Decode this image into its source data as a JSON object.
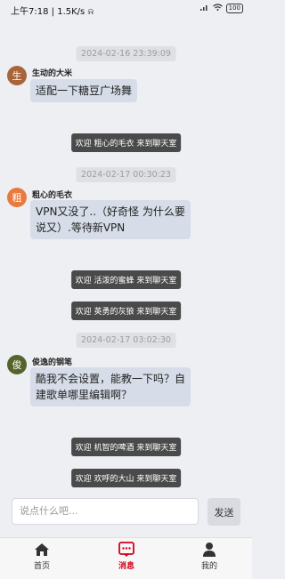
{
  "status_bar": {
    "time": "上午7:18",
    "speed": "1.5K/s",
    "battery": "100"
  },
  "messages": {
    "ts1": "2024-02-16 23:39:09",
    "m1": {
      "avatar": "生",
      "avatar_color": "#a8643a",
      "user": "生动的大米",
      "text": "适配一下糖豆广场舞"
    },
    "sys1": "欢迎 粗心的毛衣 来到聊天室",
    "ts2": "2024-02-17 00:30:23",
    "m2": {
      "avatar": "粗",
      "avatar_color": "#e87a40",
      "user": "粗心的毛衣",
      "text_line1": "VPN又没了..（好奇怪 为什么要",
      "text_line2": "说又）.等待新VPN"
    },
    "sys2": "欢迎 活泼的蜜蜂 来到聊天室",
    "sys3": "欢迎 英勇的灰狼 来到聊天室",
    "ts3": "2024-02-17 03:02:30",
    "m3": {
      "avatar": "俊",
      "avatar_color": "#55642a",
      "user": "俊逸的钢笔",
      "text_line1": "酷我不会设置，能教一下吗？自",
      "text_line2": "建歌单哪里编辑啊？"
    },
    "sys4": "欢迎 机智的啤酒 来到聊天室",
    "sys5": "欢迎 欢呼的大山 来到聊天室"
  },
  "composer": {
    "placeholder": "说点什么吧...",
    "send_label": "发送"
  },
  "nav": {
    "home": "首页",
    "messages": "消息",
    "mine": "我的",
    "active_color": "#d0021b"
  }
}
